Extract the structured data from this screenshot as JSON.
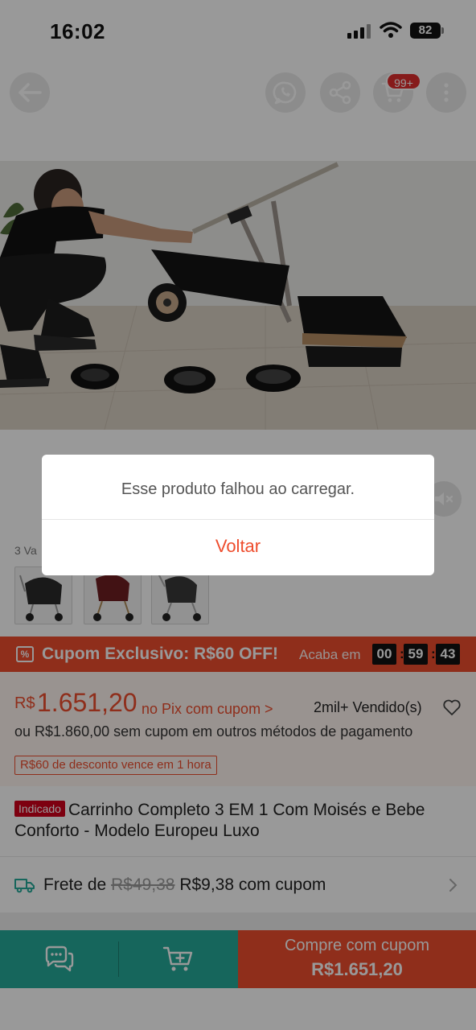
{
  "status_bar": {
    "time": "16:02",
    "battery": "82"
  },
  "header": {
    "cart_badge": "99+"
  },
  "variants": {
    "label": "3 Va"
  },
  "coupon_bar": {
    "text": "Cupom Exclusivo: R$60 OFF!",
    "icon_label": "%",
    "ends_label": "Acaba em",
    "timer": {
      "hours": "00",
      "minutes": "59",
      "seconds": "43"
    }
  },
  "price": {
    "currency": "R$",
    "value": "1.651,20",
    "pix_link": "no Pix com cupom >",
    "sold": "2mil+ Vendido(s)",
    "alt_price": "ou R$1.860,00 sem cupom em outros métodos de pagamento",
    "expire_tag": "R$60 de desconto vence em 1 hora"
  },
  "product": {
    "tag": "Indicado",
    "title": "Carrinho Completo 3 EM 1 Com Moisés e Bebe Conforto - Modelo Europeu Luxo"
  },
  "shipping": {
    "prefix": "Frete de",
    "old_price": "R$49,38",
    "new_price": "R$9,38 com cupom"
  },
  "bottom_bar": {
    "buy_line1": "Compre com cupom",
    "buy_line2": "R$1.651,20"
  },
  "dialog": {
    "message": "Esse produto falhou ao carregar.",
    "button": "Voltar"
  },
  "colors": {
    "accent": "#ee4d2d",
    "teal": "#26aa99",
    "badge_red": "#e02d2d"
  }
}
